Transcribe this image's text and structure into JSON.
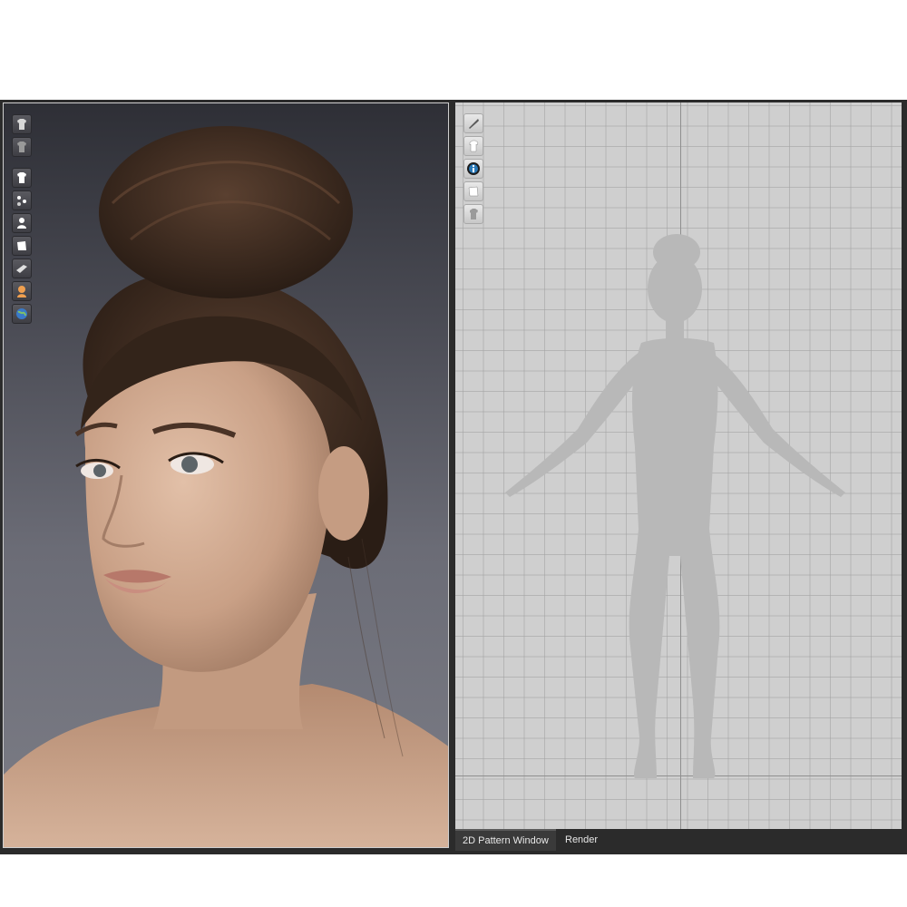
{
  "viewport3d": {
    "toolbar_icons": [
      "shirt-dark-icon",
      "shirt-grey-icon",
      "shirt-white-icon",
      "avatar-points-icon",
      "avatar-profile-icon",
      "fabric-piece-icon",
      "fabric-flat-icon",
      "avatar-orange-icon",
      "globe-icon"
    ]
  },
  "pattern_window": {
    "toolbar_icons": [
      "brush-icon",
      "eye-shirt-icon",
      "info-icon",
      "pattern-piece-icon",
      "lock-shirt-icon"
    ]
  },
  "tabs": [
    {
      "label": "2D Pattern Window",
      "active": true
    },
    {
      "label": "Render",
      "active": false
    }
  ],
  "colors": {
    "background": "#2b2b2b",
    "grid": "#cfcfcf",
    "silhouette": "#b3b3b3",
    "skin": "#d2ab91",
    "hair": "#3a2a1f"
  }
}
